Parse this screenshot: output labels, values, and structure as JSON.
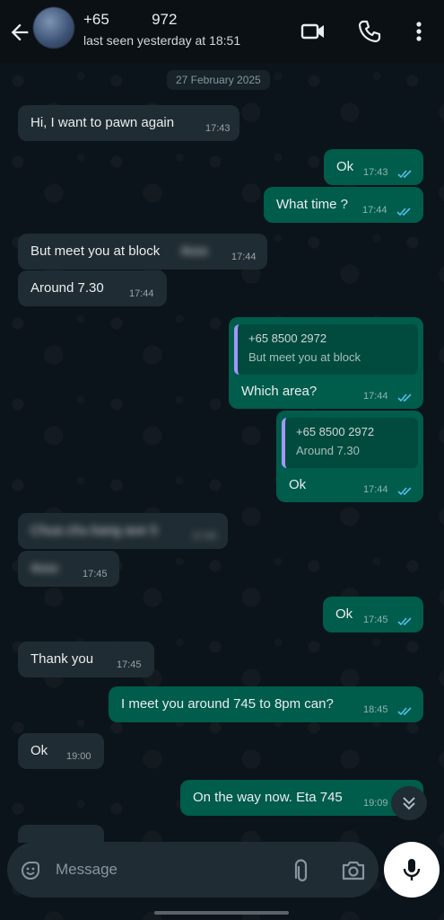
{
  "header": {
    "contact_name": "+65          972",
    "status": "last seen yesterday at 18:51",
    "icons": [
      "back-arrow-icon",
      "video-call-icon",
      "voice-call-icon",
      "more-options-icon"
    ]
  },
  "chat": {
    "date_label": "27 February 2025",
    "messages": [
      {
        "dir": "in",
        "text": "Hi, I want to pawn again",
        "time": "17:43"
      },
      {
        "dir": "out",
        "text": "Ok",
        "time": "17:43",
        "status": "read"
      },
      {
        "dir": "out",
        "text": "What time ?",
        "time": "17:44",
        "status": "read"
      },
      {
        "dir": "in",
        "text": "But meet you at block",
        "redacted_suffix": "4xxx",
        "time": "17:44"
      },
      {
        "dir": "in",
        "text": "Around 7.30",
        "time": "17:44"
      },
      {
        "dir": "out",
        "quote_author": "+65 8500 2972",
        "quote_text": "But meet you at block",
        "text": "Which area?",
        "time": "17:44",
        "status": "read"
      },
      {
        "dir": "out",
        "quote_author": "+65 8500 2972",
        "quote_text": "Around 7.30",
        "text": "Ok",
        "time": "17:44",
        "status": "read"
      },
      {
        "dir": "in",
        "text": "Chua chu kang ave 5",
        "time": "17:45",
        "redacted": true
      },
      {
        "dir": "in",
        "text": "4xxx",
        "time": "17:45",
        "redacted": true
      },
      {
        "dir": "out",
        "text": "Ok",
        "time": "17:45",
        "status": "read"
      },
      {
        "dir": "in",
        "text": "Thank you",
        "time": "17:45"
      },
      {
        "dir": "out",
        "text": "I meet you around 745 to 8pm can?",
        "time": "18:45",
        "status": "read"
      },
      {
        "dir": "in",
        "text": "Ok",
        "time": "19:00"
      },
      {
        "dir": "out",
        "text": "On the way now. Eta 745",
        "time": "19:09",
        "status": "read"
      }
    ]
  },
  "composer": {
    "placeholder": "Message",
    "icons": [
      "sticker-icon",
      "attach-icon",
      "camera-icon",
      "mic-icon"
    ]
  },
  "colors": {
    "bg": "#0b141a",
    "incoming": "#202c33",
    "outgoing": "#005c4b",
    "read_tick": "#53bdeb"
  }
}
